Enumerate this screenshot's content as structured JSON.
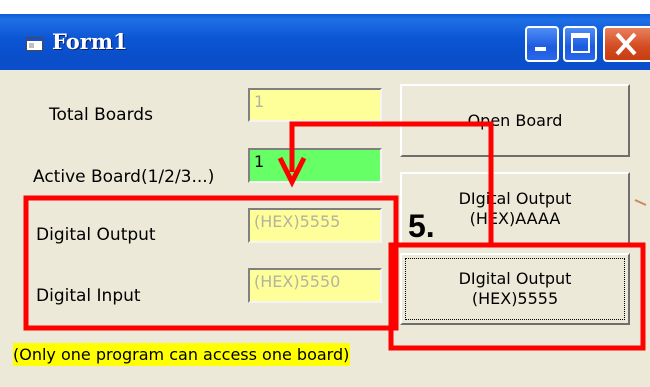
{
  "window": {
    "title": "Form1"
  },
  "title_buttons": [
    "minimize-icon",
    "maximize-icon",
    "close-icon"
  ],
  "labels": {
    "total_boards": "Total Boards",
    "active_board": "Active Board(1/2/3...)",
    "digital_output": "Digital Output",
    "digital_input": "Digital Input"
  },
  "fields": {
    "total_boards": "1",
    "active_board": "1",
    "digital_output": "(HEX)5555",
    "digital_input": "(HEX)5550"
  },
  "buttons": {
    "open_board": "Open Board",
    "output_aaaa": {
      "line1": "DIgital Output",
      "line2": "(HEX)AAAA"
    },
    "output_5555": {
      "line1": "DIgital Output",
      "line2": "(HEX)5555"
    }
  },
  "note": "(Only one program can access one board)",
  "annotation": {
    "step_label": "5.",
    "color": "#ff0000"
  },
  "colors": {
    "field_yellow": "#ffff99",
    "field_green": "#66ff66",
    "titlebar": "#0a4ec8"
  }
}
